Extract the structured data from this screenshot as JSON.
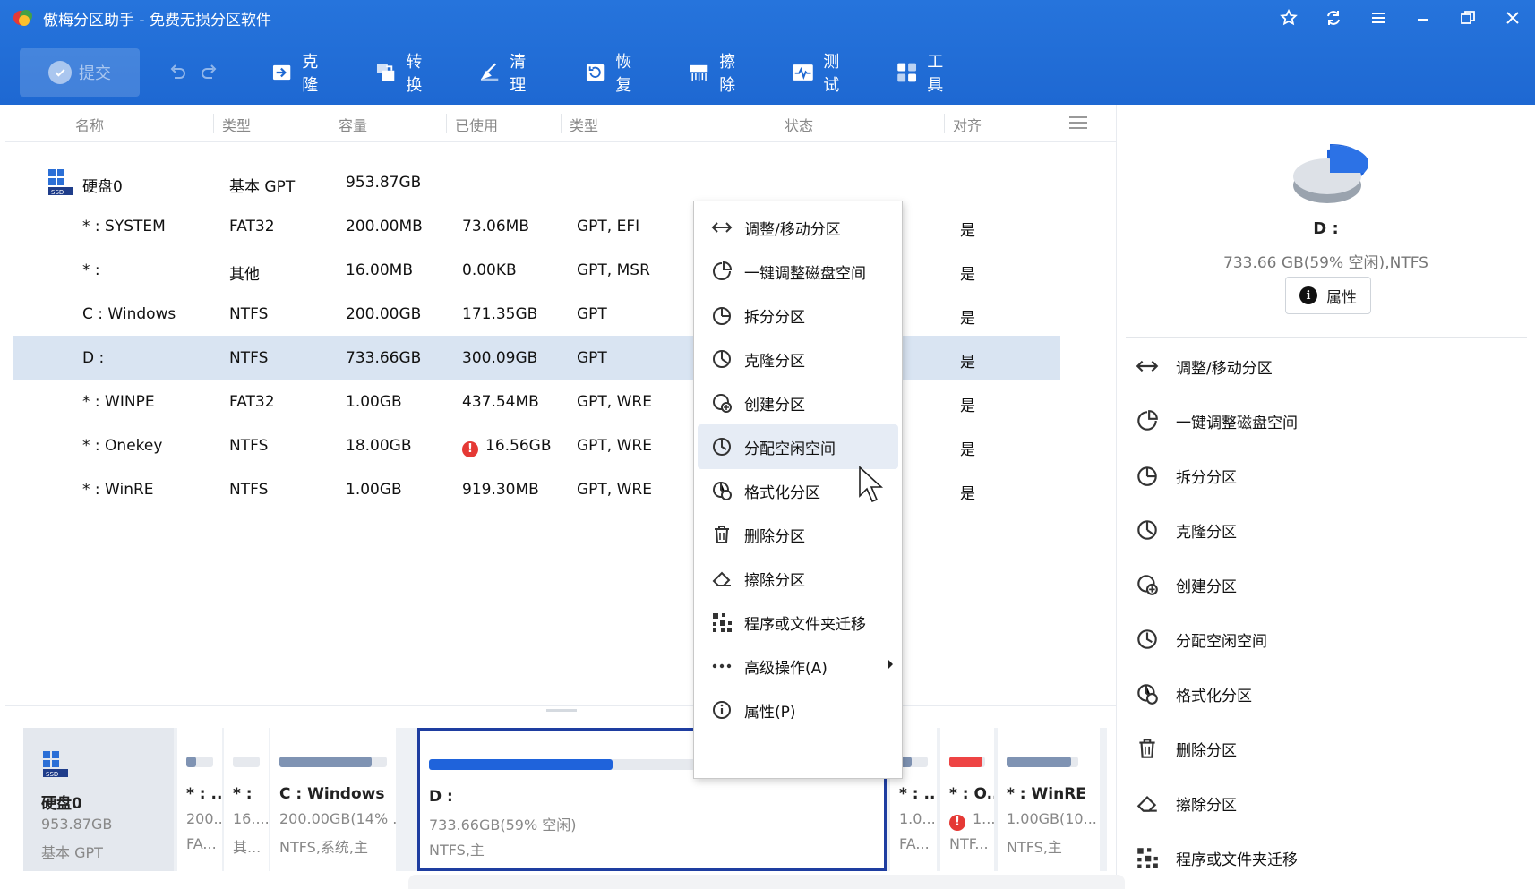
{
  "app": {
    "title": "傲梅分区助手 - 免费无损分区软件"
  },
  "toolbar": {
    "commit": "提交",
    "tools": [
      "克隆",
      "转换",
      "清理",
      "恢复",
      "擦除",
      "测试",
      "工具"
    ]
  },
  "table": {
    "headers": [
      "名称",
      "类型",
      "容量",
      "已使用",
      "类型",
      "状态",
      "对齐"
    ],
    "disk": {
      "name": "硬盘0",
      "type": "基本 GPT",
      "capacity": "953.87GB"
    },
    "rows": [
      {
        "name": "* : SYSTEM",
        "fs": "FAT32",
        "capacity": "200.00MB",
        "used": "73.06MB",
        "ptype": "GPT, EFI",
        "align": "是"
      },
      {
        "name": "* :",
        "fs": "其他",
        "capacity": "16.00MB",
        "used": "0.00KB",
        "ptype": "GPT, MSR",
        "align": "是"
      },
      {
        "name": "C : Windows",
        "fs": "NTFS",
        "capacity": "200.00GB",
        "used": "171.35GB",
        "ptype": "GPT",
        "align": "是"
      },
      {
        "name": "D :",
        "fs": "NTFS",
        "capacity": "733.66GB",
        "used": "300.09GB",
        "ptype": "GPT",
        "align": "是"
      },
      {
        "name": "* : WINPE",
        "fs": "FAT32",
        "capacity": "1.00GB",
        "used": "437.54MB",
        "ptype": "GPT, WRE",
        "align": "是"
      },
      {
        "name": "* : Onekey",
        "fs": "NTFS",
        "capacity": "18.00GB",
        "used": "16.56GB",
        "ptype": "GPT, WRE",
        "align": "是"
      },
      {
        "name": "* : WinRE",
        "fs": "NTFS",
        "capacity": "1.00GB",
        "used": "919.30MB",
        "ptype": "GPT, WRE",
        "align": "是"
      }
    ]
  },
  "context_menu": {
    "items": [
      "调整/移动分区",
      "一键调整磁盘空间",
      "拆分分区",
      "克隆分区",
      "创建分区",
      "分配空闲空间",
      "格式化分区",
      "删除分区",
      "擦除分区",
      "程序或文件夹迁移",
      "高级操作(A)",
      "属性(P)"
    ]
  },
  "right_panel": {
    "partition": "D :",
    "info": "733.66 GB(59% 空闲),NTFS",
    "properties": "属性",
    "actions": [
      "调整/移动分区",
      "一键调整磁盘空间",
      "拆分分区",
      "克隆分区",
      "创建分区",
      "分配空闲空间",
      "格式化分区",
      "删除分区",
      "擦除分区",
      "程序或文件夹迁移"
    ]
  },
  "disk_map": {
    "disk": {
      "name": "硬盘0",
      "size": "953.87GB",
      "type": "基本 GPT"
    },
    "partitions": [
      {
        "name": "* : ...",
        "size": "200...",
        "type": "FA...",
        "used_fraction": 0.37,
        "color": "#7f93b3"
      },
      {
        "name": "* :",
        "size": "16....",
        "type": "其...",
        "used_fraction": 0.0,
        "color": "#7f93b3"
      },
      {
        "name": "C : Windows",
        "size": "200.00GB(14% ...",
        "type": "NTFS,系统,主",
        "used_fraction": 0.86,
        "color": "#7f93b3"
      },
      {
        "name": "D :",
        "size": "733.66GB(59% 空闲)",
        "type": "NTFS,主",
        "used_fraction": 0.41,
        "color": "#1f63db"
      },
      {
        "name": "* : ...",
        "size": "1.0...",
        "type": "FA...",
        "used_fraction": 0.43,
        "color": "#7f93b3"
      },
      {
        "name": "* : O...",
        "size": "1...",
        "type": "NTF...",
        "used_fraction": 0.92,
        "color": "#ee4444"
      },
      {
        "name": "* : WinRE",
        "size": "1.00GB(10...",
        "type": "NTFS,主",
        "used_fraction": 0.9,
        "color": "#7f93b3"
      }
    ]
  }
}
